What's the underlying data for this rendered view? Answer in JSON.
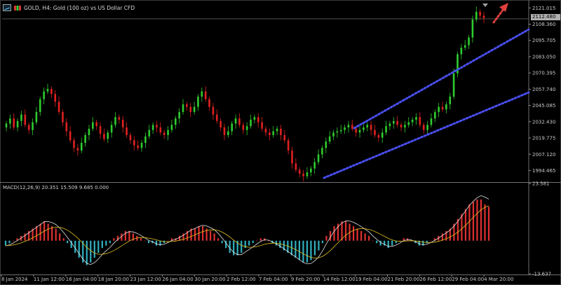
{
  "window": {
    "title": "GOLD, H4:  Gold (100 oz) vs US Dollar CFD",
    "chart_icon": "chart-window-icon",
    "symbol_icon": "symbol-bars-icon"
  },
  "price_tag": "2112.480",
  "macd_label": "MACD(12,26,9) 20.351 15.509 9.685 0.000",
  "colors": {
    "background": "#000000",
    "bull": "#2ecc2e",
    "bear": "#e02020",
    "channel": "#4a4ff0",
    "arrow": "#e04040",
    "hist_pos": "#e03030",
    "hist_neg": "#30b0c0",
    "macd_line": "#e0e0e0",
    "signal_line": "#e0c020",
    "grid": "#505050"
  },
  "chart_data": [
    {
      "type": "candlestick",
      "y_ticks": [
        "2121.015",
        "2108.360",
        "2095.705",
        "2083.050",
        "2070.395",
        "2057.740",
        "2045.085",
        "2032.430",
        "2019.775",
        "2007.120",
        "1994.465"
      ],
      "ylim": [
        1986.0,
        2125.0
      ],
      "x_ticks": [
        "8 Jan 2024",
        "11 Jan 12:00",
        "16 Jan 04:00",
        "18 Jan 20:00",
        "23 Jan 12:00",
        "26 Jan 04:00",
        "30 Jan 20:00",
        "2 Feb 12:00",
        "7 Feb 04:00",
        "9 Feb 20:00",
        "14 Feb 12:00",
        "19 Feb 04:00",
        "21 Feb 20:00",
        "26 Feb 12:00",
        "29 Feb 04:00",
        "4 Mar 20:00"
      ],
      "close_series": [
        2031,
        2035,
        2028,
        2033,
        2038,
        2030,
        2026,
        2032,
        2040,
        2050,
        2056,
        2058,
        2054,
        2048,
        2040,
        2032,
        2025,
        2018,
        2012,
        2010,
        2016,
        2022,
        2027,
        2032,
        2029,
        2023,
        2019,
        2024,
        2030,
        2036,
        2034,
        2028,
        2022,
        2018,
        2014,
        2012,
        2016,
        2021,
        2026,
        2030,
        2028,
        2024,
        2022,
        2026,
        2030,
        2035,
        2040,
        2046,
        2044,
        2040,
        2044,
        2052,
        2056,
        2050,
        2044,
        2038,
        2033,
        2028,
        2022,
        2025,
        2031,
        2035,
        2030,
        2026,
        2029,
        2034,
        2036,
        2032,
        2027,
        2024,
        2022,
        2025,
        2027,
        2022,
        2018,
        2010,
        2000,
        1995,
        1992,
        1990,
        1993,
        1996,
        2001,
        2007,
        2012,
        2017,
        2021,
        2024,
        2025,
        2026,
        2028,
        2030,
        2027,
        2024,
        2026,
        2028,
        2030,
        2026,
        2022,
        2020,
        2024,
        2029,
        2031,
        2033,
        2030,
        2028,
        2030,
        2032,
        2034,
        2036,
        2030,
        2026,
        2030,
        2035,
        2040,
        2044,
        2042,
        2046,
        2052,
        2070,
        2085,
        2090,
        2092,
        2098,
        2112,
        2118,
        2115,
        2113
      ],
      "annotations": [
        "ascending channel upper line",
        "ascending channel lower line",
        "projected up arrow"
      ]
    },
    {
      "type": "macd",
      "title": "MACD(12,26,9) 20.351 15.509 9.685 0.000",
      "y_ticks": [
        "23.581",
        "-13.637"
      ],
      "ylim": [
        -13.637,
        23.581
      ],
      "histogram": [
        -2,
        -1,
        0,
        1,
        2,
        3,
        4,
        5,
        6,
        7,
        8,
        7,
        6,
        5,
        3,
        1,
        -1,
        -3,
        -5,
        -7,
        -9,
        -10,
        -9,
        -7,
        -5,
        -3,
        -2,
        -1,
        1,
        2,
        3,
        4,
        4,
        3,
        2,
        1,
        0,
        -1,
        -1,
        -2,
        -2,
        -1,
        0,
        1,
        1,
        2,
        3,
        4,
        5,
        5,
        6,
        6,
        5,
        4,
        3,
        1,
        -1,
        -3,
        -5,
        -6,
        -6,
        -5,
        -3,
        -2,
        -1,
        0,
        1,
        1,
        0,
        -1,
        -2,
        -3,
        -4,
        -5,
        -6,
        -7,
        -8,
        -9,
        -9,
        -8,
        -6,
        -4,
        -1,
        2,
        4,
        6,
        7,
        8,
        8,
        7,
        6,
        5,
        4,
        3,
        2,
        0,
        -1,
        -2,
        -2,
        -3,
        -2,
        -1,
        0,
        1,
        1,
        0,
        -1,
        -2,
        -2,
        -1,
        0,
        1,
        2,
        3,
        4,
        5,
        7,
        9,
        11,
        13,
        15,
        16,
        17,
        17,
        15,
        14
      ]
    }
  ]
}
